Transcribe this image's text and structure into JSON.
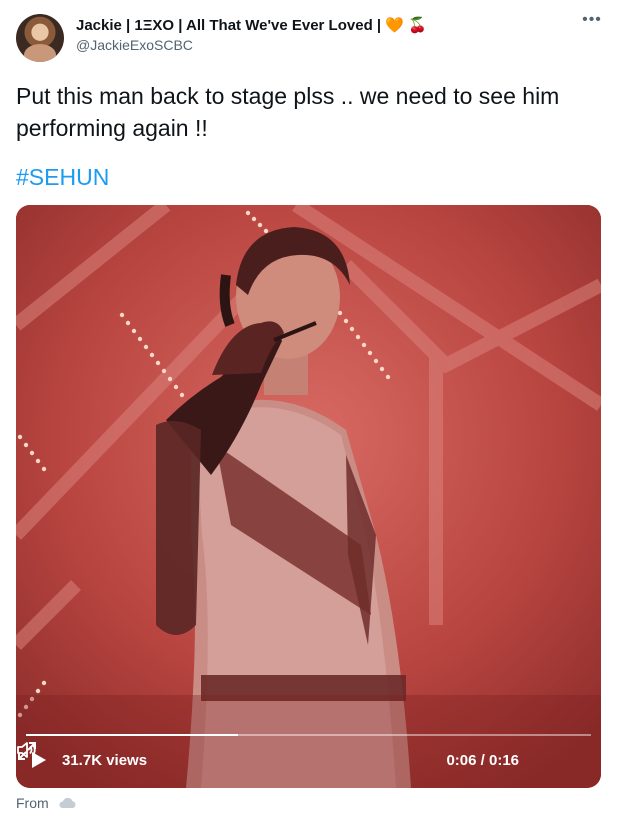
{
  "author": {
    "display_name": "Jackie | 1ΞXO | All That We've Ever Loved |",
    "heart_emoji": "🧡",
    "cherry_emoji": "🍒",
    "handle": "@JackieExoSCBC"
  },
  "menu": {
    "more_label": "•••"
  },
  "tweet": {
    "text": "Put this man back to stage plss .. we need to see him performing again !!",
    "hashtag": "#SEHUN"
  },
  "video": {
    "views": "31.7K views",
    "time": "0:06 / 0:16",
    "progress": 0.375
  },
  "footer": {
    "from_label": "From"
  },
  "colors": {
    "link": "#1d9bf0",
    "secondary_text": "#536471",
    "video_tint": "#b8403e"
  }
}
